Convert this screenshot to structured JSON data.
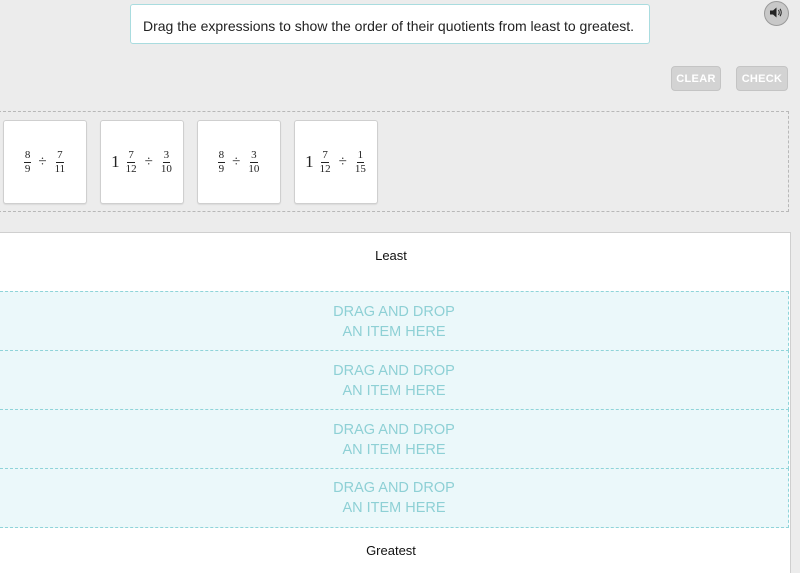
{
  "prompt": {
    "text": "Drag the expressions to show the order of their quotients from least to greatest.",
    "audio_icon": "speaker-icon"
  },
  "toolbar": {
    "clear_label": "CLEAR",
    "check_label": "CHECK"
  },
  "tiles": [
    {
      "whole": "",
      "a_num": "8",
      "a_den": "9",
      "op": "÷",
      "b_num": "7",
      "b_den": "11"
    },
    {
      "whole": "1",
      "a_num": "7",
      "a_den": "12",
      "op": "÷",
      "b_num": "3",
      "b_den": "10"
    },
    {
      "whole": "",
      "a_num": "8",
      "a_den": "9",
      "op": "÷",
      "b_num": "3",
      "b_den": "10"
    },
    {
      "whole": "1",
      "a_num": "7",
      "a_den": "12",
      "op": "÷",
      "b_num": "1",
      "b_den": "15"
    }
  ],
  "order": {
    "least_label": "Least",
    "greatest_label": "Greatest",
    "slots": [
      {
        "line1": "DRAG AND DROP",
        "line2": "AN ITEM HERE"
      },
      {
        "line1": "DRAG AND DROP",
        "line2": "AN ITEM HERE"
      },
      {
        "line1": "DRAG AND DROP",
        "line2": "AN ITEM HERE"
      },
      {
        "line1": "DRAG AND DROP",
        "line2": "AN ITEM HERE"
      }
    ]
  }
}
